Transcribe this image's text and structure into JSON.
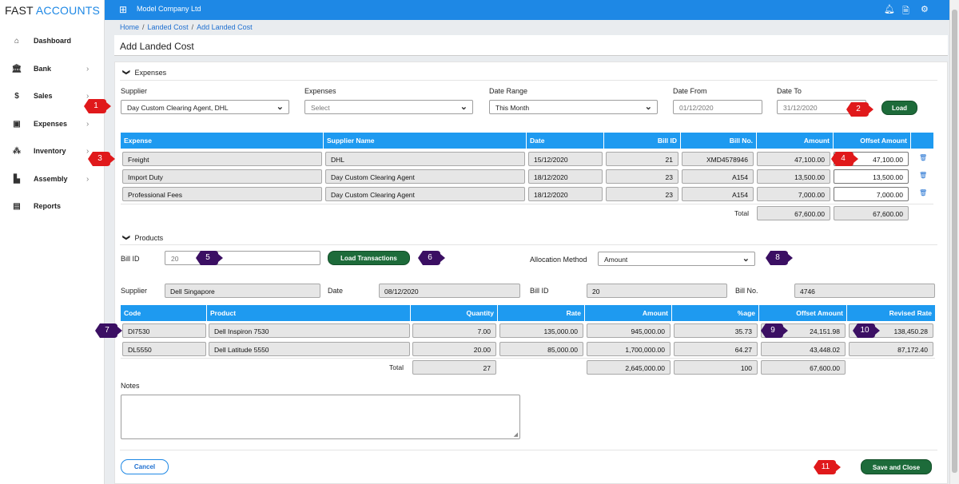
{
  "app": {
    "brand_a": "FAST",
    "brand_b": "ACCOUNTS",
    "company": "Model Company Ltd"
  },
  "sidebar": {
    "items": [
      {
        "label": "Dashboard",
        "icon": "home-icon",
        "chev": ""
      },
      {
        "label": "Bank",
        "icon": "bank-icon",
        "chev": "›"
      },
      {
        "label": "Sales",
        "icon": "dollar-icon",
        "chev": "›"
      },
      {
        "label": "Expenses",
        "icon": "cash-icon",
        "chev": "›"
      },
      {
        "label": "Inventory",
        "icon": "boxes-icon",
        "chev": "›"
      },
      {
        "label": "Assembly",
        "icon": "factory-icon",
        "chev": "›"
      },
      {
        "label": "Reports",
        "icon": "report-icon",
        "chev": ""
      }
    ]
  },
  "breadcrumb": {
    "home": "Home",
    "parent": "Landed Cost",
    "current": "Add Landed Cost",
    "sep": "/"
  },
  "page": {
    "title": "Add Landed Cost"
  },
  "expenses": {
    "section_title": "Expenses",
    "supplier_label": "Supplier",
    "supplier_value": "Day Custom Clearing Agent, DHL",
    "expenses_label": "Expenses",
    "expenses_value": "Select",
    "date_range_label": "Date Range",
    "date_range_value": "This Month",
    "date_from_label": "Date From",
    "date_from_value": "01/12/2020",
    "date_to_label": "Date To",
    "date_to_value": "31/12/2020",
    "load_label": "Load",
    "columns": [
      "Expense",
      "Supplier Name",
      "Date",
      "Bill ID",
      "Bill No.",
      "Amount",
      "Offset Amount"
    ],
    "rows": [
      {
        "expense": "Freight",
        "supplier": "DHL",
        "date": "15/12/2020",
        "bill_id": "21",
        "bill_no": "XMD4578946",
        "amount": "47,100.00",
        "offset": "47,100.00"
      },
      {
        "expense": "Import Duty",
        "supplier": "Day Custom Clearing Agent",
        "date": "18/12/2020",
        "bill_id": "23",
        "bill_no": "A154",
        "amount": "13,500.00",
        "offset": "13,500.00"
      },
      {
        "expense": "Professional Fees",
        "supplier": "Day Custom Clearing Agent",
        "date": "18/12/2020",
        "bill_id": "23",
        "bill_no": "A154",
        "amount": "7,000.00",
        "offset": "7,000.00"
      }
    ],
    "total_label": "Total",
    "total_amount": "67,600.00",
    "total_offset": "67,600.00"
  },
  "products": {
    "section_title": "Products",
    "bill_id_label": "Bill ID",
    "bill_id_value": "20",
    "load_transactions_label": "Load Transactions",
    "allocation_label": "Allocation Method",
    "allocation_value": "Amount",
    "info_supplier_label": "Supplier",
    "info_supplier_value": "Dell Singapore",
    "info_date_label": "Date",
    "info_date_value": "08/12/2020",
    "info_bill_id_label": "Bill ID",
    "info_bill_id_value": "20",
    "info_bill_no_label": "Bill No.",
    "info_bill_no_value": "4746",
    "columns": [
      "Code",
      "Product",
      "Quantity",
      "Rate",
      "Amount",
      "%age",
      "Offset Amount",
      "Revised Rate"
    ],
    "rows": [
      {
        "code": "DI7530",
        "product": "Dell Inspiron 7530",
        "qty": "7.00",
        "rate": "135,000.00",
        "amount": "945,000.00",
        "pct": "35.73",
        "offset": "24,151.98",
        "revised": "138,450.28"
      },
      {
        "code": "DL5550",
        "product": "Dell Latitude 5550",
        "qty": "20.00",
        "rate": "85,000.00",
        "amount": "1,700,000.00",
        "pct": "64.27",
        "offset": "43,448.02",
        "revised": "87,172.40"
      }
    ],
    "total_label": "Total",
    "total_qty": "27",
    "total_amount": "2,645,000.00",
    "total_pct": "100",
    "total_offset": "67,600.00"
  },
  "notes": {
    "label": "Notes"
  },
  "footer": {
    "cancel_label": "Cancel",
    "save_label": "Save and Close"
  },
  "markers": [
    "1",
    "2",
    "3",
    "4",
    "5",
    "6",
    "7",
    "8",
    "9",
    "10",
    "11"
  ],
  "colors": {
    "primary": "#1e88e5",
    "header": "#1e9af0",
    "button_green": "#1d6b3a",
    "marker_red": "#e0191b",
    "marker_purple": "#3b0f63"
  }
}
